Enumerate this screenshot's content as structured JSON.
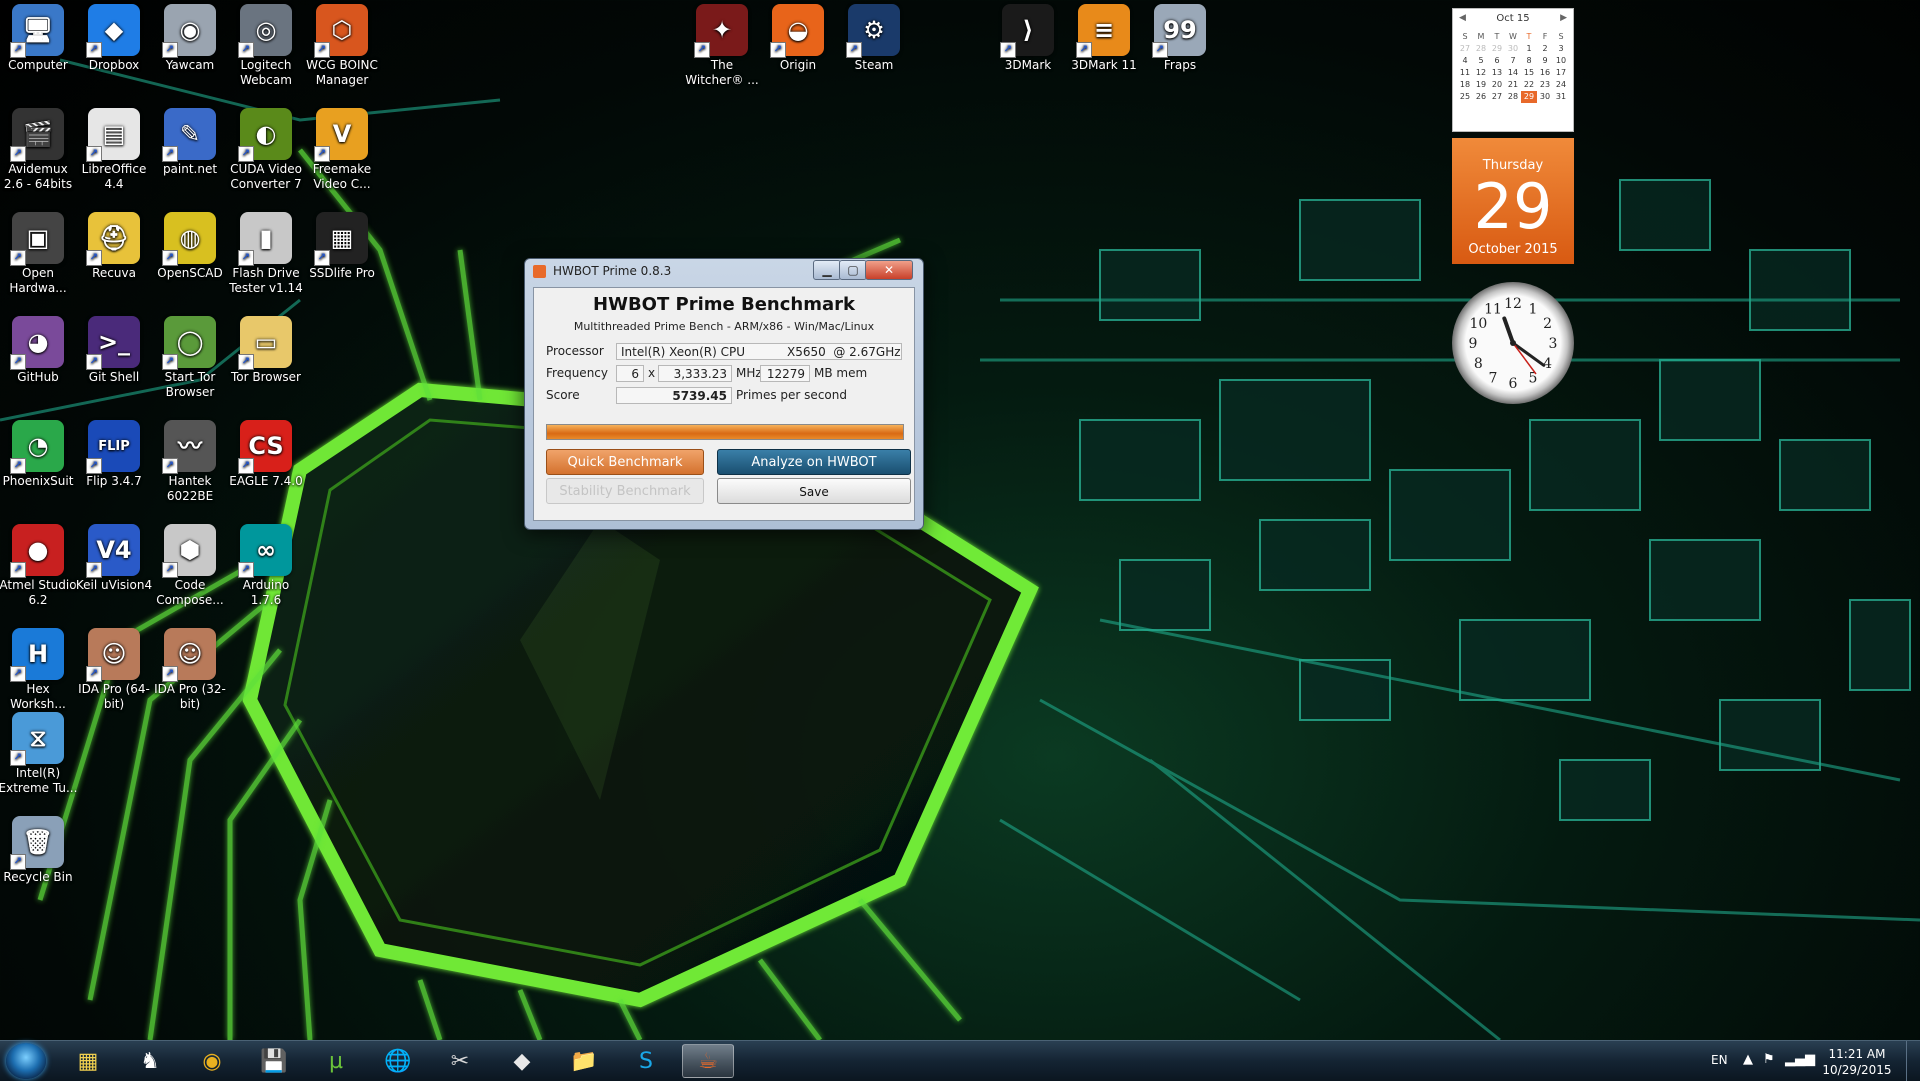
{
  "desktop_icons": [
    {
      "label": "Computer",
      "icon": "computer-icon",
      "color": "#3a78c8",
      "glyph": "🖥"
    },
    {
      "label": "Dropbox",
      "icon": "dropbox-icon",
      "color": "#1f7de6",
      "glyph": "◆"
    },
    {
      "label": "Yawcam",
      "icon": "webcam-icon",
      "color": "#9aa4b0",
      "glyph": "◉"
    },
    {
      "label": "Logitech Webcam",
      "icon": "logitech-webcam-icon",
      "color": "#6a7480",
      "glyph": "◎"
    },
    {
      "label": "WCG BOINC Manager",
      "icon": "boinc-icon",
      "color": "#d8561e",
      "glyph": "⬡"
    },
    {
      "label": "Avidemux 2.6 - 64bits",
      "icon": "clapperboard-icon",
      "color": "#333333",
      "glyph": "🎬"
    },
    {
      "label": "LibreOffice 4.4",
      "icon": "libreoffice-icon",
      "color": "#e6e6e6",
      "glyph": "▤"
    },
    {
      "label": "paint.net",
      "icon": "paint-icon",
      "color": "#3a6ac8",
      "glyph": "✎"
    },
    {
      "label": "CUDA Video Converter 7",
      "icon": "nvidia-icon",
      "color": "#5a8a1a",
      "glyph": "◐"
    },
    {
      "label": "Freemake Video C...",
      "icon": "freemake-icon",
      "color": "#e8a020",
      "glyph": "V"
    },
    {
      "label": "Open Hardwa...",
      "icon": "chip-icon",
      "color": "#444444",
      "glyph": "▣"
    },
    {
      "label": "Recuva",
      "icon": "recuva-icon",
      "color": "#e8c23a",
      "glyph": "⛑"
    },
    {
      "label": "OpenSCAD",
      "icon": "openscad-icon",
      "color": "#d8c020",
      "glyph": "◍"
    },
    {
      "label": "Flash Drive Tester v1.14",
      "icon": "usb-drive-icon",
      "color": "#c8c8c8",
      "glyph": "▮"
    },
    {
      "label": "SSDlife Pro",
      "icon": "ssd-icon",
      "color": "#222222",
      "glyph": "▦"
    },
    {
      "label": "GitHub",
      "icon": "github-icon",
      "color": "#7a4a9a",
      "glyph": "◕"
    },
    {
      "label": "Git Shell",
      "icon": "git-shell-icon",
      "color": "#4a2a7a",
      "glyph": ">_"
    },
    {
      "label": "Start Tor Browser",
      "icon": "tor-globe-icon",
      "color": "#5a9a3a",
      "glyph": "◯"
    },
    {
      "label": "Tor Browser",
      "icon": "folder-icon",
      "color": "#e8c86a",
      "glyph": "▭"
    },
    {
      "label": "PhoenixSuit",
      "icon": "phoenixsuit-icon",
      "color": "#2aa84a",
      "glyph": "◔"
    },
    {
      "label": "Flip 3.4.7",
      "icon": "atmel-flip-icon",
      "color": "#1a4ab8",
      "glyph": "FLIP"
    },
    {
      "label": "Hantek 6022BE",
      "icon": "oscilloscope-icon",
      "color": "#555555",
      "glyph": "〰"
    },
    {
      "label": "EAGLE 7.4.0",
      "icon": "eagle-icon",
      "color": "#d8201a",
      "glyph": "CS"
    },
    {
      "label": "Atmel Studio 6.2",
      "icon": "ladybug-icon",
      "color": "#c82020",
      "glyph": "●"
    },
    {
      "label": "Keil uVision4",
      "icon": "keil-icon",
      "color": "#2a5ac8",
      "glyph": "V4"
    },
    {
      "label": "Code Compose...",
      "icon": "cube-icon",
      "color": "#c8c8c8",
      "glyph": "⬢"
    },
    {
      "label": "Arduino 1.7.6",
      "icon": "arduino-icon",
      "color": "#00979c",
      "glyph": "∞"
    },
    {
      "label": "Hex Worksh...",
      "icon": "hex-workshop-icon",
      "color": "#1a7ad8",
      "glyph": "H"
    },
    {
      "label": "IDA Pro (64-bit)",
      "icon": "ida-pro-icon",
      "color": "#b87a5a",
      "glyph": "☺"
    },
    {
      "label": "IDA Pro (32-bit)",
      "icon": "ida-pro-icon",
      "color": "#b87a5a",
      "glyph": "☺"
    },
    {
      "label": "Intel(R) Extreme Tu...",
      "icon": "intel-xtu-icon",
      "color": "#4a9ad8",
      "glyph": "⧖"
    },
    {
      "label": "Recycle Bin",
      "icon": "recycle-bin-icon",
      "color": "#8aa0b8",
      "glyph": "🗑"
    }
  ],
  "top_icons": [
    {
      "label": "The Witcher® ...",
      "icon": "witcher-icon",
      "color": "#7a1a1a",
      "glyph": "✦"
    },
    {
      "label": "Origin",
      "icon": "origin-icon",
      "color": "#e8641a",
      "glyph": "◒"
    },
    {
      "label": "Steam",
      "icon": "steam-icon",
      "color": "#1a3a6a",
      "glyph": "⚙"
    },
    {
      "label": "3DMark",
      "icon": "3dmark-icon",
      "color": "#1a1a1a",
      "glyph": "⟩"
    },
    {
      "label": "3DMark 11",
      "icon": "3dmark11-icon",
      "color": "#e88a1a",
      "glyph": "≡"
    },
    {
      "label": "Fraps",
      "icon": "fraps-icon",
      "color": "#9aa8b8",
      "glyph": "99"
    }
  ],
  "window": {
    "title": "HWBOT Prime 0.8.3",
    "minimize": "▁",
    "maximize": "▢",
    "close": "✕",
    "heading": "HWBOT Prime Benchmark",
    "subheading": "Multithreaded Prime Bench - ARM/x86 - Win/Mac/Linux",
    "processor_label": "Processor",
    "processor_value": "Intel(R) Xeon(R) CPU           X5650  @ 2.67GHz",
    "frequency_label": "Frequency",
    "multiplier": "6",
    "times": "x",
    "frequency_value": "3,333.23",
    "mhz_unit": "MHz",
    "memory_value": "12279",
    "memory_unit": "MB mem",
    "score_label": "Score",
    "score_value": "5739.45",
    "score_unit": "Primes per second",
    "progress_percent": 100,
    "quick_benchmark": "Quick Benchmark",
    "analyze": "Analyze on HWBOT",
    "stability": "Stability Benchmark",
    "save": "Save"
  },
  "calendar": {
    "month_label": "Oct 15",
    "prev": "◀",
    "next": "▶",
    "weekdays": [
      "S",
      "M",
      "T",
      "W",
      "T",
      "F",
      "S"
    ],
    "days": [
      {
        "d": "27",
        "dim": true
      },
      {
        "d": "28",
        "dim": true
      },
      {
        "d": "29",
        "dim": true
      },
      {
        "d": "30",
        "dim": true
      },
      {
        "d": "1"
      },
      {
        "d": "2"
      },
      {
        "d": "3"
      },
      {
        "d": "4"
      },
      {
        "d": "5"
      },
      {
        "d": "6"
      },
      {
        "d": "7"
      },
      {
        "d": "8"
      },
      {
        "d": "9"
      },
      {
        "d": "10"
      },
      {
        "d": "11"
      },
      {
        "d": "12"
      },
      {
        "d": "13"
      },
      {
        "d": "14"
      },
      {
        "d": "15"
      },
      {
        "d": "16"
      },
      {
        "d": "17"
      },
      {
        "d": "18"
      },
      {
        "d": "19"
      },
      {
        "d": "20"
      },
      {
        "d": "21"
      },
      {
        "d": "22"
      },
      {
        "d": "23"
      },
      {
        "d": "24"
      },
      {
        "d": "25"
      },
      {
        "d": "26"
      },
      {
        "d": "27"
      },
      {
        "d": "28"
      },
      {
        "d": "29",
        "today": true
      },
      {
        "d": "30"
      },
      {
        "d": "31"
      }
    ],
    "weekday": "Thursday",
    "day": "29",
    "month_year": "October 2015"
  },
  "clock": {
    "numerals": [
      "12",
      "1",
      "2",
      "3",
      "4",
      "5",
      "6",
      "7",
      "8",
      "9",
      "10",
      "11"
    ],
    "hour": 11,
    "minute": 21
  },
  "taskbar": {
    "items": [
      {
        "icon": "start-screen-icon",
        "glyph": "▦",
        "color": "#f0d050"
      },
      {
        "icon": "fox-icon",
        "glyph": "♞",
        "color": "#ffffff"
      },
      {
        "icon": "chrome-icon",
        "glyph": "◉",
        "color": "#e8b020"
      },
      {
        "icon": "floppy-icon",
        "glyph": "💾",
        "color": "#4a6ad8"
      },
      {
        "icon": "utorrent-icon",
        "glyph": "µ",
        "color": "#6ac23a"
      },
      {
        "icon": "network-globe-icon",
        "glyph": "🌐",
        "color": "#8ab8e8"
      },
      {
        "icon": "wrench-tools-icon",
        "glyph": "✂",
        "color": "#d8d8d8"
      },
      {
        "icon": "inkscape-icon",
        "glyph": "◆",
        "color": "#e8e8e8"
      },
      {
        "icon": "explorer-folder-icon",
        "glyph": "📁",
        "color": "#e8c050"
      },
      {
        "icon": "skype-icon",
        "glyph": "S",
        "color": "#1aa8e8"
      },
      {
        "icon": "java-icon",
        "glyph": "☕",
        "color": "#e86a2a",
        "active": true
      }
    ],
    "language": "EN",
    "time": "11:21 AM",
    "date": "10/29/2015"
  }
}
